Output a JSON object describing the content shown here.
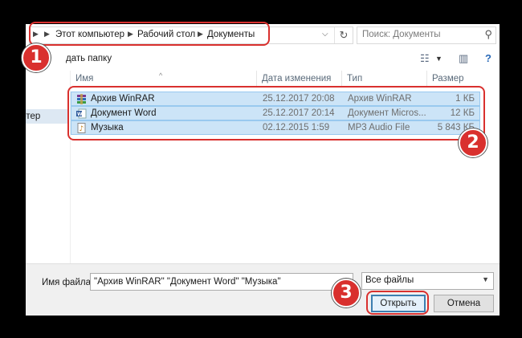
{
  "address": {
    "crumbs": [
      "Этот компьютер",
      "Рабочий стол",
      "Документы"
    ]
  },
  "search": {
    "placeholder": "Поиск: Документы"
  },
  "toolbar": {
    "new_folder": "дать папку"
  },
  "sidebar": {
    "item": "ютер"
  },
  "columns": {
    "name": "Имя",
    "date": "Дата изменения",
    "type": "Тип",
    "size": "Размер"
  },
  "files": [
    {
      "name": "Архив WinRAR",
      "date": "25.12.2017 20:08",
      "type": "Архив WinRAR",
      "size": "1 КБ",
      "icon": "winrar-archive-icon"
    },
    {
      "name": "Документ Word",
      "date": "25.12.2017 20:14",
      "type": "Документ Micros...",
      "size": "12 КБ",
      "icon": "word-document-icon"
    },
    {
      "name": "Музыка",
      "date": "02.12.2015 1:59",
      "type": "MP3 Audio File",
      "size": "5 843 КБ",
      "icon": "mp3-file-icon"
    }
  ],
  "footer": {
    "filename_label": "Имя файла:",
    "filename_value": "\"Архив WinRAR\" \"Документ Word\" \"Музыка\"",
    "filter": "Все файлы",
    "open": "Открыть",
    "cancel": "Отмена"
  },
  "annotations": {
    "one": "1",
    "two": "2",
    "three": "3",
    "color": "#d9302e"
  }
}
